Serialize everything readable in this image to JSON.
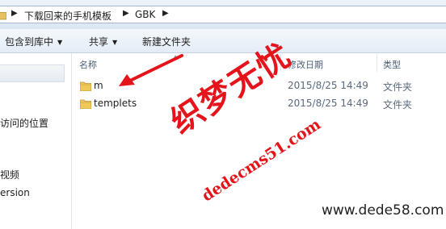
{
  "address_bar": {
    "breadcrumbs": [
      "下载回来的手机模板",
      "GBK"
    ]
  },
  "toolbar": {
    "include_library": "包含到库中",
    "share": "共享",
    "new_folder": "新建文件夹"
  },
  "nav_pane": {
    "items": [
      "访问的位置",
      "视频",
      "ersion"
    ]
  },
  "file_list": {
    "columns": {
      "name": "名称",
      "date_modified": "修改日期",
      "type": "类型"
    },
    "rows": [
      {
        "name": "m",
        "date": "2015/8/25 14:49",
        "type": "文件夹"
      },
      {
        "name": "templets",
        "date": "2015/8/25 14:49",
        "type": "文件夹"
      }
    ]
  },
  "annotations": {
    "watermark_brand": "织梦无忧",
    "watermark_url": "dedecms51.com",
    "site_url": "www.dede58.com",
    "arrow_color": "#e5141b"
  },
  "icons": [
    "folder-icon",
    "breadcrumb-arrow-icon",
    "dropdown-caret-icon",
    "sort-caret-icon",
    "red-arrow-icon"
  ]
}
